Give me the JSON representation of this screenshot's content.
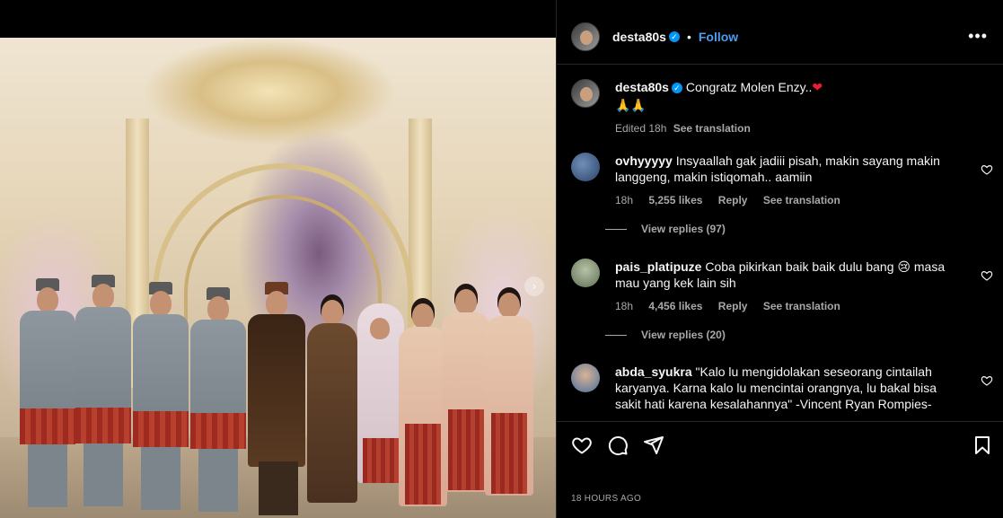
{
  "post": {
    "username": "desta80s",
    "follow_label": "Follow",
    "more_label": "•••",
    "time_ago": "18 HOURS AGO"
  },
  "caption": {
    "username": "desta80s",
    "text": "Congratz Molen Enzy..",
    "emoji_line": "🙏🙏",
    "edited": "Edited",
    "age": "18h",
    "see_translation": "See translation"
  },
  "comments": [
    {
      "username": "ovhyyyyy",
      "text": "Insyaallah gak jadiii pisah, makin sayang makin langgeng, makin istiqomah.. aamiin",
      "age": "18h",
      "likes": "5,255 likes",
      "reply": "Reply",
      "see_translation": "See translation",
      "view_replies": "View replies (97)",
      "avatar_color": "#3d5a80"
    },
    {
      "username": "pais_platipuze",
      "text": "Coba pikirkan baik baik dulu bang 😢 masa mau yang kek lain sih",
      "age": "18h",
      "likes": "4,456 likes",
      "reply": "Reply",
      "see_translation": "See translation",
      "view_replies": "View replies (20)",
      "avatar_color": "#8a9a7a"
    },
    {
      "username": "abda_syukra",
      "text": "\"Kalo lu mengidolakan seseorang cintailah karyanya. Karna kalo lu mencintai orangnya, lu bakal bisa sakit hati karena kesalahannya\" -Vincent Ryan Rompies-",
      "avatar_color": "#c7a07e"
    }
  ],
  "colors": {
    "accent": "#4a9df2",
    "verified": "#0095f6",
    "heart_red": "#ed1c33",
    "muted": "#a8a8a8"
  },
  "icons": {
    "like": "heart-icon",
    "comment": "comment-icon",
    "share": "share-icon",
    "save": "bookmark-icon"
  }
}
